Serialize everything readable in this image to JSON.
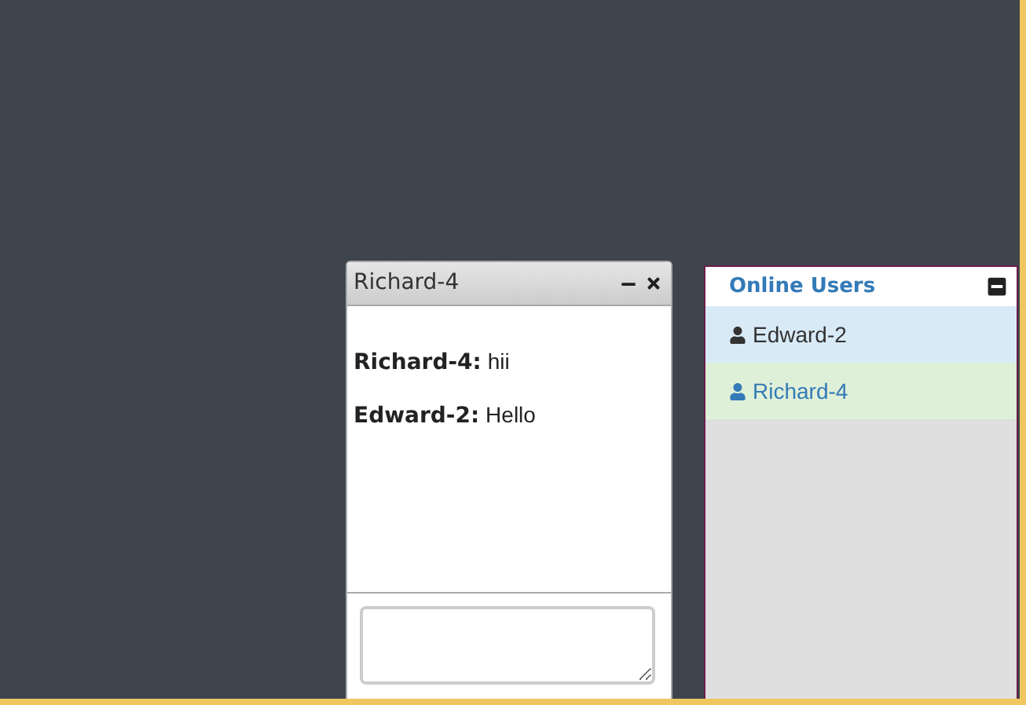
{
  "chat_window": {
    "title": "Richard-4",
    "messages": [
      {
        "sender": "Richard-4:",
        "text": "hii"
      },
      {
        "sender": "Edward-2:",
        "text": "Hello"
      }
    ]
  },
  "online_users": {
    "title": "Online Users",
    "users": [
      {
        "name": "Edward-2",
        "kind": "other"
      },
      {
        "name": "Richard-4",
        "kind": "self"
      }
    ]
  }
}
